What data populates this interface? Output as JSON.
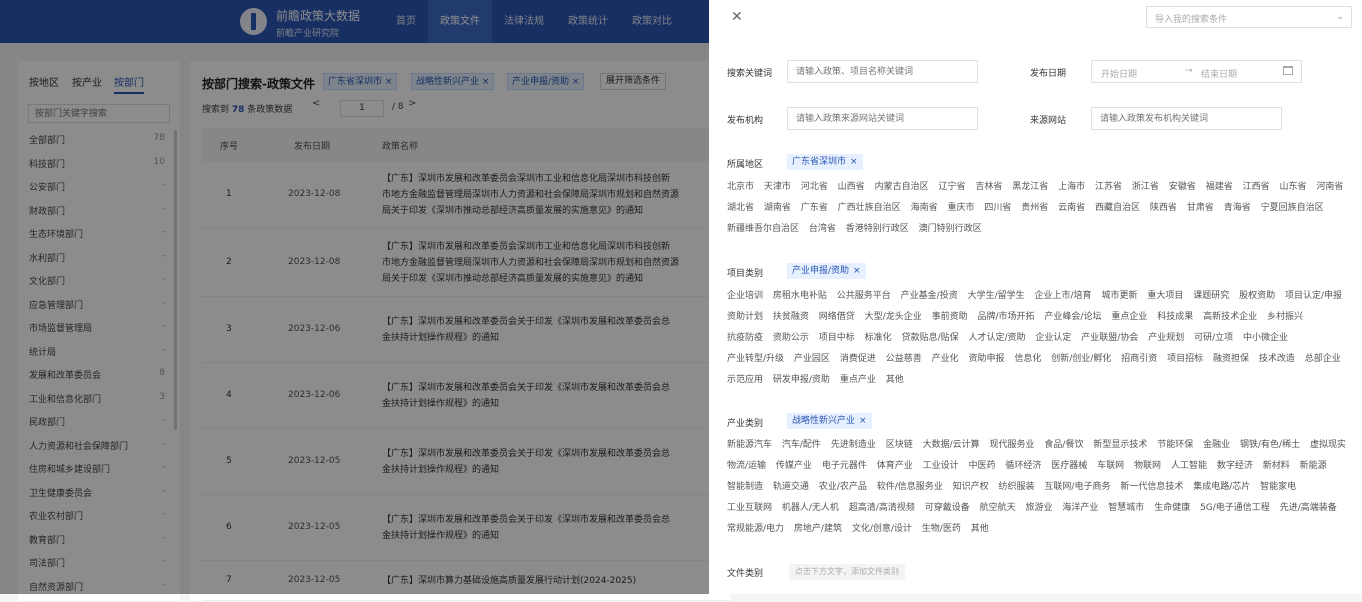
{
  "header": {
    "logo_title": "前瞻政策大数据",
    "logo_subtitle": "前瞻产业研究院",
    "nav": [
      "首页",
      "政策文件",
      "法律法规",
      "政策统计",
      "政策对比"
    ],
    "nav_active": "政策文件"
  },
  "left": {
    "tabs": [
      "按地区",
      "按产业",
      "按部门"
    ],
    "active_tab": "按部门",
    "search_placeholder": "按部门关键字搜索",
    "departments": [
      {
        "name": "全部部门",
        "count": "78"
      },
      {
        "name": "科技部门",
        "count": "10"
      },
      {
        "name": "公安部门",
        "count": "-"
      },
      {
        "name": "财政部门",
        "count": "-"
      },
      {
        "name": "生态环境部门",
        "count": "-"
      },
      {
        "name": "水利部门",
        "count": "-"
      },
      {
        "name": "文化部门",
        "count": "-"
      },
      {
        "name": "应急管理部门",
        "count": "-"
      },
      {
        "name": "市场监督管理局",
        "count": "-"
      },
      {
        "name": "统计局",
        "count": "-"
      },
      {
        "name": "发展和改革委员会",
        "count": "8"
      },
      {
        "name": "工业和信息化部门",
        "count": "3"
      },
      {
        "name": "民政部门",
        "count": "-"
      },
      {
        "name": "人力资源和社会保障部门",
        "count": "-"
      },
      {
        "name": "住房和城乡建设部门",
        "count": "-"
      },
      {
        "name": "卫生健康委员会",
        "count": "-"
      },
      {
        "name": "农业农村部门",
        "count": "-"
      },
      {
        "name": "教育部门",
        "count": "-"
      },
      {
        "name": "司法部门",
        "count": "-"
      },
      {
        "name": "自然资源部门",
        "count": "-"
      }
    ]
  },
  "main": {
    "title": "按部门搜索-政策文件",
    "chips": [
      "广东省深圳市",
      "战略性新兴产业",
      "产业申报/资助"
    ],
    "expand_label": "展开筛选条件",
    "summary_prefix": "搜索到",
    "summary_count": "78",
    "summary_suffix": "条政策数据",
    "prev": "<",
    "page_value": "1",
    "page_total": "/ 8",
    "next": ">",
    "columns": [
      "序号",
      "发布日期",
      "政策名称"
    ],
    "rows": [
      {
        "no": "1",
        "date": "2023-12-08",
        "lines": [
          "【广东】深圳市发展和改革委员会深圳市工业和信息化局深圳市科技创新",
          "市地方金融监督管理局深圳市人力资源和社会保障局深圳市规划和自然资源",
          "局关于印发《深圳市推动总部经济高质量发展的实施意见》的通知"
        ]
      },
      {
        "no": "2",
        "date": "2023-12-08",
        "lines": [
          "【广东】深圳市发展和改革委员会深圳市工业和信息化局深圳市科技创新",
          "市地方金融监督管理局深圳市人力资源和社会保障局深圳市规划和自然资源",
          "局关于印发《深圳市推动总部经济高质量发展的实施意见》的通知"
        ]
      },
      {
        "no": "3",
        "date": "2023-12-06",
        "lines": [
          "【广东】深圳市发展和改革委员会关于印发《深圳市发展和改革委员会总",
          "金扶持计划操作规程》的通知"
        ]
      },
      {
        "no": "4",
        "date": "2023-12-06",
        "lines": [
          "【广东】深圳市发展和改革委员会关于印发《深圳市发展和改革委员会总",
          "金扶持计划操作规程》的通知"
        ]
      },
      {
        "no": "5",
        "date": "2023-12-05",
        "lines": [
          "【广东】深圳市发展和改革委员会关于印发《深圳市发展和改革委员会总",
          "金扶持计划操作规程》的通知"
        ]
      },
      {
        "no": "6",
        "date": "2023-12-05",
        "lines": [
          "【广东】深圳市发展和改革委员会关于印发《深圳市发展和改革委员会总",
          "金扶持计划操作规程》的通知"
        ]
      },
      {
        "no": "7",
        "date": "2023-12-05",
        "lines": [
          "【广东】深圳市算力基础设施高质量发展行动计划(2024-2025)"
        ]
      }
    ]
  },
  "drawer": {
    "import_placeholder": "导入我的搜索条件",
    "keyword_label": "搜索关键词",
    "keyword_placeholder": "请输入政策、项目名称关键词",
    "date_label": "发布日期",
    "date_start": "开始日期",
    "date_arrow": "→",
    "date_end": "结束日期",
    "org_label": "发布机构",
    "org_placeholder": "请输入政策来源网站关键词",
    "source_label": "来源网站",
    "source_placeholder": "请输入政策发布机构关键词",
    "region_title": "所属地区",
    "region_selected": "广东省深圳市",
    "regions": [
      "北京市",
      "天津市",
      "河北省",
      "山西省",
      "内蒙古自治区",
      "辽宁省",
      "吉林省",
      "黑龙江省",
      "上海市",
      "江苏省",
      "浙江省",
      "安徽省",
      "福建省",
      "江西省",
      "山东省",
      "河南省",
      "湖北省",
      "湖南省",
      "广东省",
      "广西壮族自治区",
      "海南省",
      "重庆市",
      "四川省",
      "贵州省",
      "云南省",
      "西藏自治区",
      "陕西省",
      "甘肃省",
      "青海省",
      "宁夏回族自治区",
      "新疆维吾尔自治区",
      "台湾省",
      "香港特别行政区",
      "澳门特别行政区"
    ],
    "project_title": "项目类别",
    "project_selected": "产业申报/资助",
    "projects": [
      "企业培训",
      "房租水电补贴",
      "公共服务平台",
      "产业基金/投资",
      "大学生/留学生",
      "企业上市/培育",
      "城市更新",
      "重大项目",
      "课题研究",
      "股权资助",
      "项目认定/申报",
      "资助计划",
      "扶贫融资",
      "网络借贷",
      "大型/龙头企业",
      "事前资助",
      "品牌/市场开拓",
      "产业峰会/论坛",
      "重点企业",
      "科技成果",
      "高新技术企业",
      "乡村振兴",
      "抗疫防疫",
      "资助公示",
      "项目中标",
      "标准化",
      "贷款贴息/贴保",
      "人才认定/资助",
      "企业认定",
      "产业联盟/协会",
      "产业规划",
      "可研/立项",
      "中小微企业",
      "产业转型/升级",
      "产业园区",
      "消费促进",
      "公益慈善",
      "产业化",
      "资助申报",
      "信息化",
      "创新/创业/孵化",
      "招商引资",
      "项目招标",
      "融资担保",
      "技术改造",
      "总部企业",
      "示范应用",
      "研发申报/资助",
      "重点产业",
      "其他"
    ],
    "industry_title": "产业类别",
    "industry_selected": "战略性新兴产业",
    "industries": [
      "新能源汽车",
      "汽车/配件",
      "先进制造业",
      "区块链",
      "大数据/云计算",
      "现代服务业",
      "食品/餐饮",
      "新型显示技术",
      "节能环保",
      "金融业",
      "钢铁/有色/稀土",
      "虚拟现实",
      "物流/运输",
      "传媒产业",
      "电子元器件",
      "体育产业",
      "工业设计",
      "中医药",
      "循环经济",
      "医疗器械",
      "车联网",
      "物联网",
      "人工智能",
      "数字经济",
      "新材料",
      "新能源",
      "智能制造",
      "轨道交通",
      "农业/农产品",
      "软件/信息服务业",
      "知识产权",
      "纺织服装",
      "互联网/电子商务",
      "新一代信息技术",
      "集成电路/芯片",
      "智能家电",
      "工业互联网",
      "机器人/无人机",
      "超高清/高清视频",
      "可穿戴设备",
      "航空航天",
      "旅游业",
      "海洋产业",
      "智慧城市",
      "生命健康",
      "5G/电子通信工程",
      "先进/高端装备",
      "常规能源/电力",
      "房地产/建筑",
      "文化/创意/设计",
      "生物/医药",
      "其他"
    ],
    "filetype_title": "文件类别",
    "filetype_hint": "点击下方文字，添加文件类别"
  }
}
